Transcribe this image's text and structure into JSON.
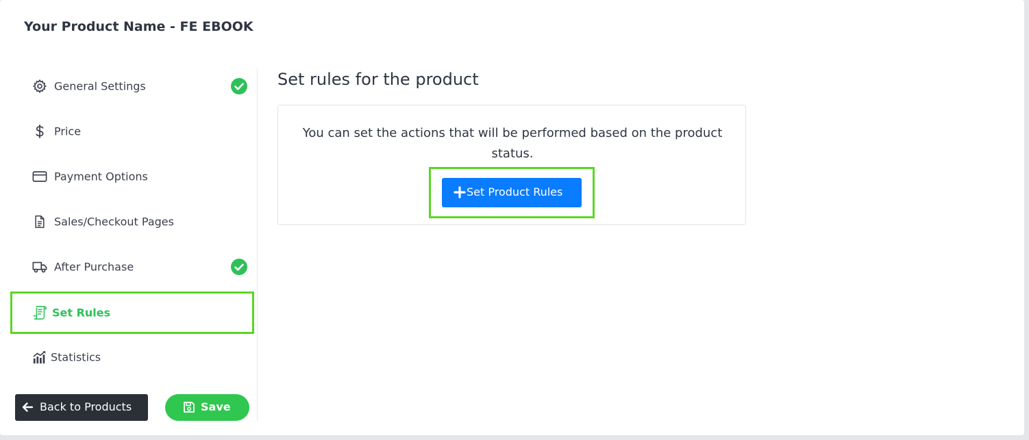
{
  "product_title": "Your Product Name - FE EBOOK",
  "sidebar": {
    "items": [
      {
        "label": "General Settings",
        "icon": "gear-icon",
        "completed": true
      },
      {
        "label": "Price",
        "icon": "dollar-icon",
        "completed": false
      },
      {
        "label": "Payment Options",
        "icon": "credit-card-icon",
        "completed": false
      },
      {
        "label": "Sales/Checkout Pages",
        "icon": "document-icon",
        "completed": false
      },
      {
        "label": "After Purchase",
        "icon": "truck-icon",
        "completed": true
      },
      {
        "label": "Set Rules",
        "icon": "receipt-icon",
        "completed": false,
        "active": true
      },
      {
        "label": "Statistics",
        "icon": "chart-icon",
        "completed": false
      }
    ],
    "back_label": "Back to Products",
    "save_label": "Save"
  },
  "main": {
    "heading": "Set rules for the product",
    "description": "You can set the actions that will be performed based on the product status.",
    "button_label": "Set Product Rules"
  },
  "colors": {
    "accent_green": "#2ec15a",
    "highlight_green": "#5ad625",
    "primary_blue": "#0a7cff",
    "dark_button": "#2b2f36"
  }
}
